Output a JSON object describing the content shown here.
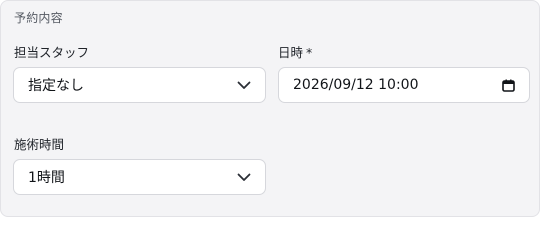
{
  "section": {
    "title": "予約内容"
  },
  "staff": {
    "label": "担当スタッフ",
    "value": "指定なし"
  },
  "datetime": {
    "label": "日時",
    "required_mark": "*",
    "value": "2026/09/12 10:00"
  },
  "duration": {
    "label": "施術時間",
    "value": "1時間"
  },
  "icons": {
    "dropdown": "chevron-down-icon",
    "calendar": "calendar-icon"
  }
}
